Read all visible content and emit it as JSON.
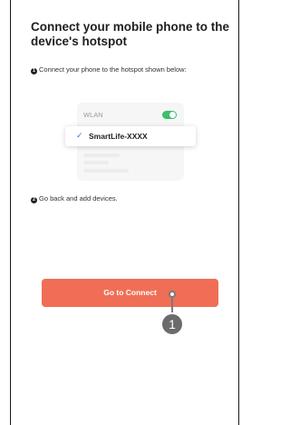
{
  "title": "Connect your mobile phone to the device's hotspot",
  "steps": [
    {
      "number": "1",
      "text": "Connect your phone to the hotspot shown below:"
    },
    {
      "number": "2",
      "text": "Go back and add devices."
    }
  ],
  "illustration": {
    "wlan_label": "WLAN",
    "toggle_state": "on",
    "toggle_color": "#3cc06b",
    "selected_network": "SmartLife-XXXX",
    "check_icon": "checkmark-icon"
  },
  "action": {
    "button_label": "Go to Connect",
    "button_color": "#ef6e55"
  },
  "annotation": {
    "badge_label": "1"
  }
}
